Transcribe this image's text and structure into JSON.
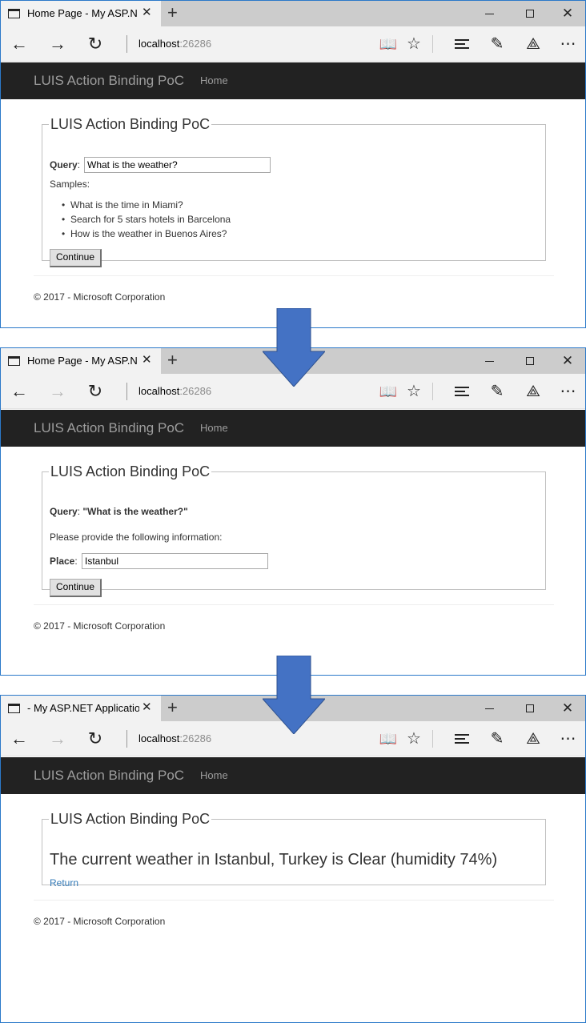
{
  "colors": {
    "window_border": "#2b79c9",
    "navbar_bg": "#222222",
    "navbar_text": "#9d9d9d",
    "link": "#337ab7",
    "arrow_fill": "#4472c4"
  },
  "common": {
    "new_tab_symbol": "+",
    "url_host": "localhost",
    "url_port": ":26286",
    "brand": "LUIS Action Binding PoC",
    "nav_home": "Home",
    "panel_legend": "LUIS Action Binding PoC",
    "footer": "© 2017 - Microsoft Corporation",
    "icons": [
      "page-icon",
      "close-icon",
      "minimize-icon",
      "maximize-icon",
      "back-icon",
      "forward-icon",
      "refresh-icon",
      "reading-view-icon",
      "favorite-star-icon",
      "hub-icon",
      "web-note-icon",
      "share-icon",
      "more-icon"
    ]
  },
  "windows": [
    {
      "tab_title": "Home Page - My ASP.N",
      "forward_enabled": true,
      "query_label": "Query",
      "query_value": "What is the weather?",
      "samples_label": "Samples:",
      "samples": [
        "What is the time in Miami?",
        "Search for 5 stars hotels in Barcelona",
        "How is the weather in Buenos Aires?"
      ],
      "button": "Continue"
    },
    {
      "tab_title": "Home Page - My ASP.N",
      "forward_enabled": false,
      "query_label": "Query",
      "query_value": "\"What is the weather?\"",
      "prompt": "Please provide the following information:",
      "place_label": "Place",
      "place_value": "Istanbul",
      "button": "Continue"
    },
    {
      "tab_title": "- My ASP.NET Applicatio",
      "forward_enabled": false,
      "result": "The current weather in Istanbul, Turkey is Clear (humidity 74%)",
      "return_link": "Return"
    }
  ]
}
